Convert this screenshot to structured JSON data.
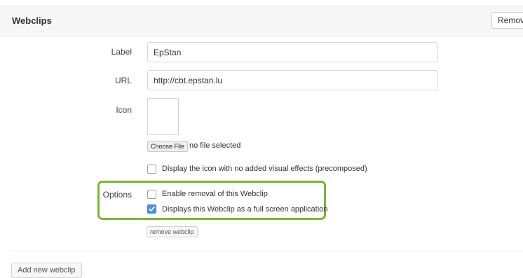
{
  "header": {
    "title": "Webclips",
    "remove_label": "Remove"
  },
  "form": {
    "label_label": "Label",
    "label_value": "EpStan",
    "url_label": "URL",
    "url_value": "http://cbt.epstan.lu",
    "icon_label": "Icon",
    "choose_file_label": "Choose File",
    "no_file_text": "no file selected",
    "precomposed_label": "Display the icon with no added visual effects (precomposed)",
    "precomposed_checked": false,
    "options_label": "Options",
    "enable_removal_label": "Enable removal of this Webclip",
    "enable_removal_checked": false,
    "full_screen_label": "Displays this Webclip as a full screen application",
    "full_screen_checked": true,
    "remove_webclip_label": "remove webclip"
  },
  "footer": {
    "add_label": "Add new webclip"
  },
  "colors": {
    "highlight": "#7ab530",
    "checkbox_checked": "#4a90e2"
  },
  "icons": {
    "checkmark": "check-icon"
  }
}
